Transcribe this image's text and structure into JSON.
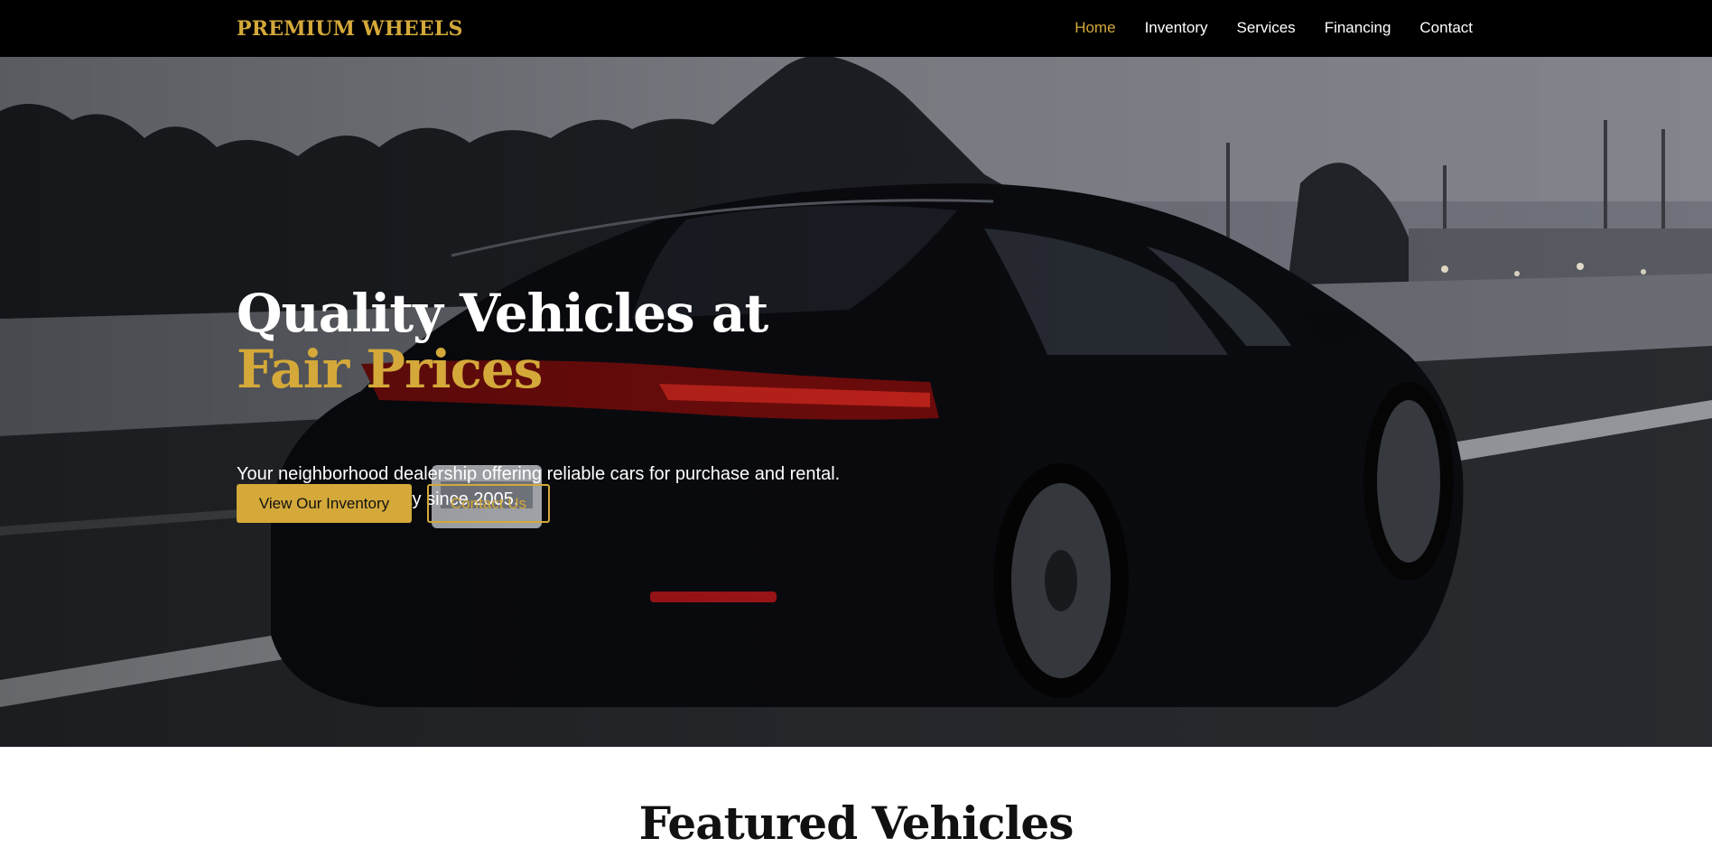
{
  "header": {
    "logo": "PREMIUM WHEELS",
    "nav": [
      {
        "label": "Home",
        "active": true
      },
      {
        "label": "Inventory",
        "active": false
      },
      {
        "label": "Services",
        "active": false
      },
      {
        "label": "Financing",
        "active": false
      },
      {
        "label": "Contact",
        "active": false
      }
    ]
  },
  "hero": {
    "title_main": "Quality Vehicles at ",
    "title_accent": "Fair Prices",
    "subtitle": "Your neighborhood dealership offering reliable cars for purchase and rental. Serving our community since 2005.",
    "primary_button": "View Our Inventory",
    "secondary_button": "Contact Us",
    "image_label": "hero-car-photo"
  },
  "featured": {
    "title": "Featured Vehicles"
  },
  "colors": {
    "accent": "#d4a93a",
    "header_bg": "#000000",
    "text_dark": "#111111"
  }
}
